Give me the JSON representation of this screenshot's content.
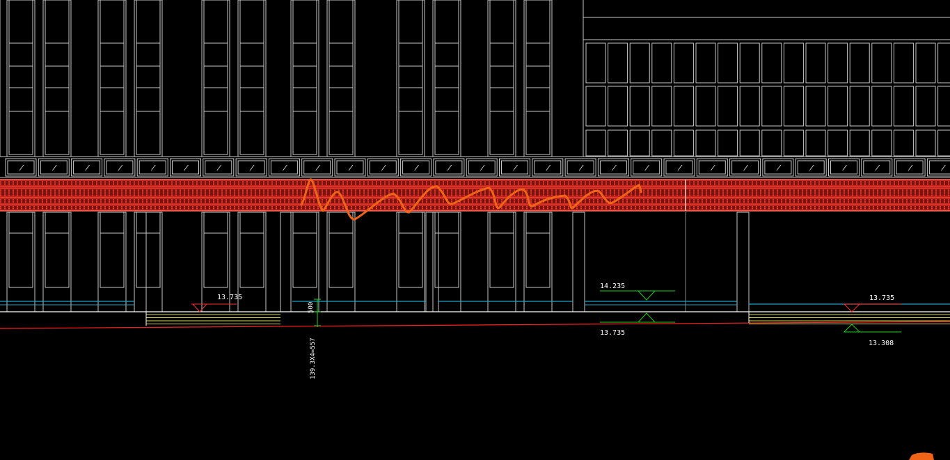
{
  "drawing": {
    "background_color": "#000000",
    "window_line_color": "#c8c8c8",
    "brick_band_color": "#c0261e",
    "brick_band_line_color": "#ff4a3a",
    "ground_line_color": "#ff2020",
    "cyan_line_color": "#1fa3c8",
    "level_marker_color": "#1fcf1f",
    "stair_line_color": "#d8d84a",
    "annotation_color": "#f06418"
  },
  "labels": {
    "elev_left_top": "13.735",
    "elev_mid_top": "14.235",
    "elev_mid_bottom": "13.735",
    "elev_right_top": "13.735",
    "elev_right_bottom": "13.308",
    "dim_vertical": "500",
    "dim_formula": "139.3X4=557"
  }
}
